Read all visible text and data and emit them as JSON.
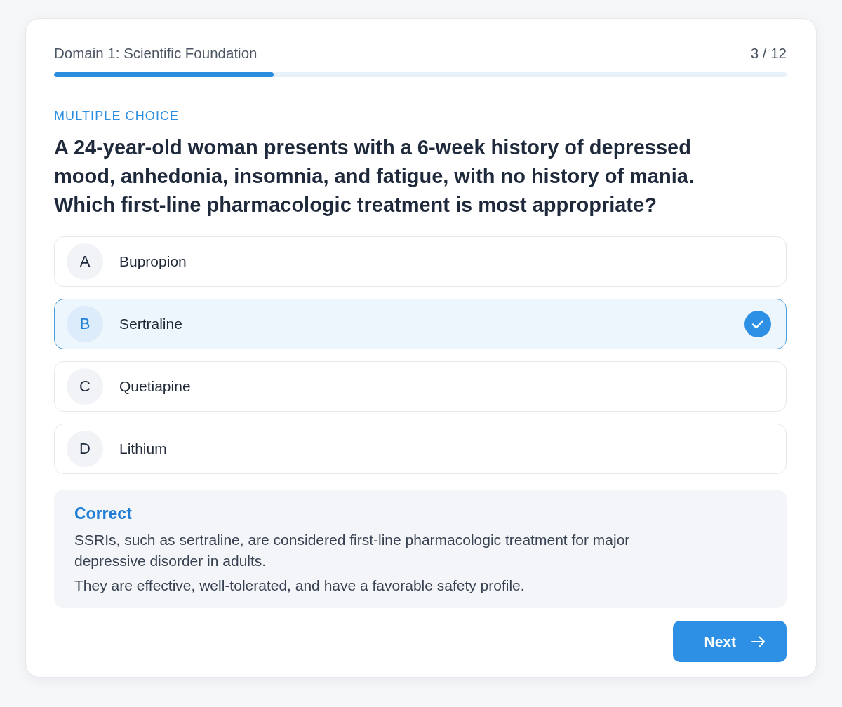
{
  "header": {
    "domain": "Domain 1: Scientific Foundation",
    "counter": "3 / 12",
    "progress": {
      "level": 0.3
    }
  },
  "question": {
    "type_label": "MULTIPLE CHOICE",
    "text": "A 24-year-old woman presents with a 6-week history of depressed mood, anhedonia, insomnia, and fatigue, with no history of mania. Which first-line pharmacologic treatment is most appropriate?"
  },
  "options": [
    {
      "letter": "A",
      "label": "Bupropion",
      "selected": false
    },
    {
      "letter": "B",
      "label": "Sertraline",
      "selected": true
    },
    {
      "letter": "C",
      "label": "Quetiapine",
      "selected": false
    },
    {
      "letter": "D",
      "label": "Lithium",
      "selected": false
    }
  ],
  "feedback": {
    "title": "Correct",
    "paragraphs": [
      "SSRIs, such as sertraline, are considered first-line pharmacologic treatment for major depressive disorder in adults.",
      "They are effective, well-tolerated, and have a favorable safety profile."
    ]
  },
  "next_button": {
    "label": "Next"
  }
}
